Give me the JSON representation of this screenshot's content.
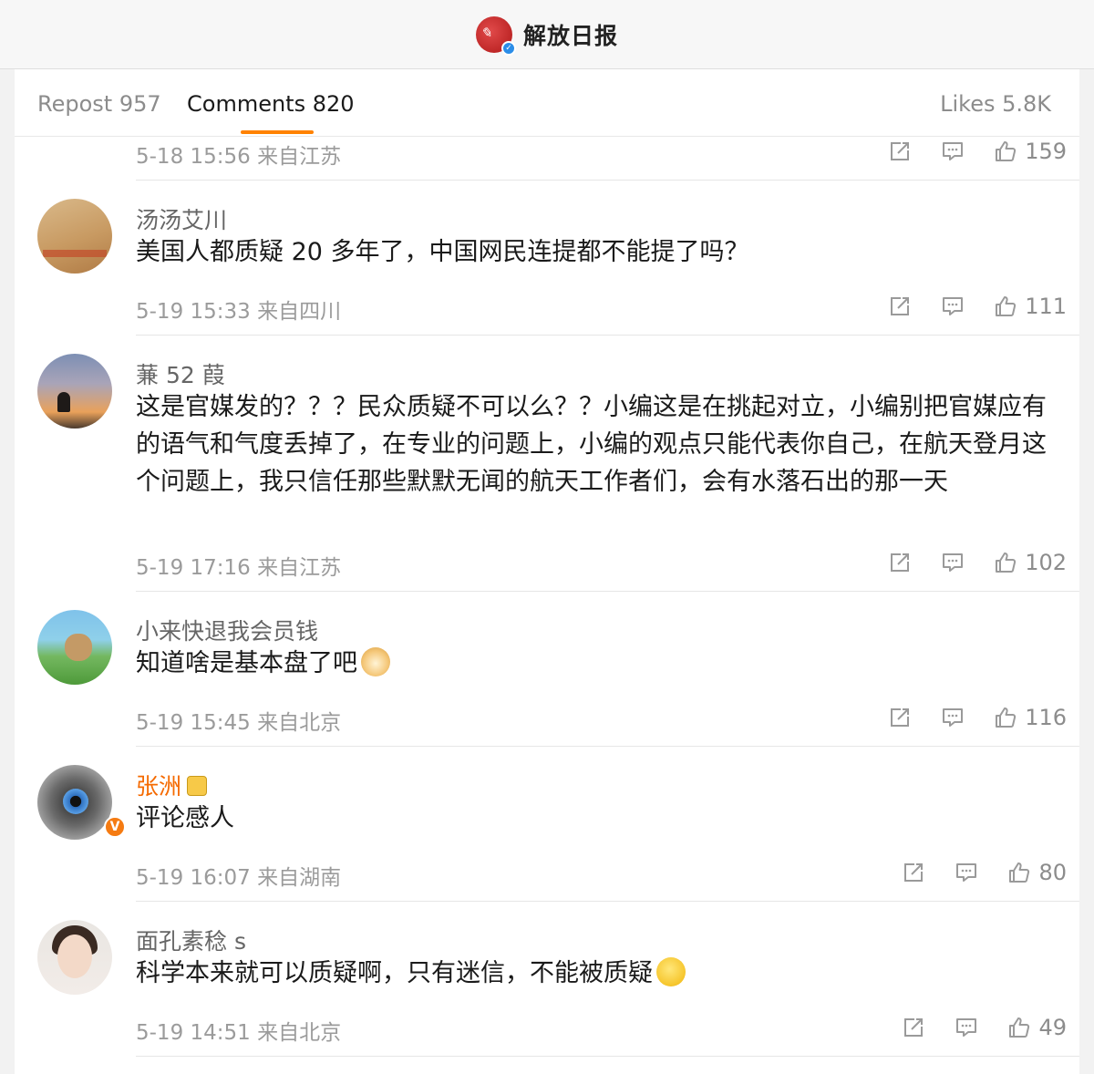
{
  "header": {
    "account_name": "解放日报"
  },
  "tabs": {
    "reposts": "Repost 957",
    "comments": "Comments 820",
    "likes": "Likes 5.8K"
  },
  "colors": {
    "accent": "#ff8200",
    "vip_name": "#f56a00",
    "verified": "#2b8de8"
  },
  "icons": {
    "share": "share-icon",
    "reply": "reply-icon",
    "like": "thumbs-up-icon"
  },
  "partial_comment": {
    "meta": "5-18 15:56 来自江苏",
    "likes": "159"
  },
  "comments": [
    {
      "username": "汤汤艾川",
      "text": "美国人都质疑 20 多年了，中国网民连提都不能提了吗？",
      "meta": "5-19 15:33 来自四川",
      "likes": "111"
    },
    {
      "username": "蒹 52 葭",
      "text": "这是官媒发的？？？民众质疑不可以么？？小编这是在挑起对立，小编别把官媒应有的语气和气度丢掉了，在专业的问题上，小编的观点只能代表你自己，在航天登月这个问题上，我只信任那些默默无闻的航天工作者们，会有水落石出的那一天",
      "meta": "5-19 17:16 来自江苏",
      "likes": "102"
    },
    {
      "username": "小来快退我会员钱",
      "text": "知道啥是基本盘了吧",
      "meta": "5-19 15:45 来自北京",
      "likes": "116"
    },
    {
      "username": "张洲",
      "text": "评论感人",
      "meta": "5-19 16:07 来自湖南",
      "likes": "80",
      "verified_badge": "V"
    },
    {
      "username": "面孔素稔 s",
      "text": "科学本来就可以质疑啊，只有迷信，不能被质疑",
      "meta": "5-19 14:51 来自北京",
      "likes": "49"
    }
  ]
}
